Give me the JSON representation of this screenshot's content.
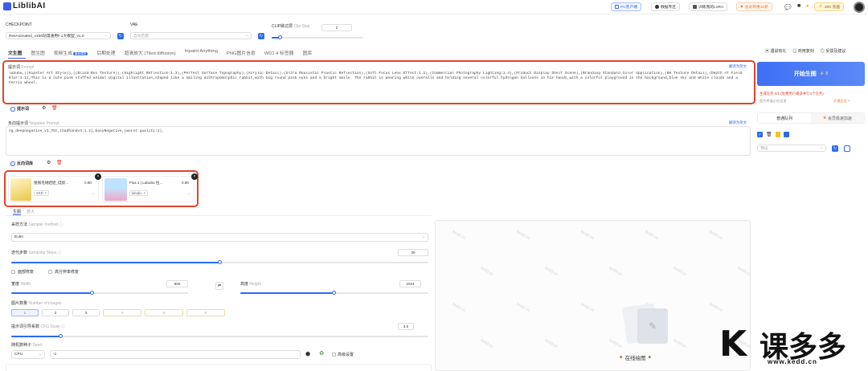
{
  "header": {
    "logo_text": "LiblibAI",
    "pills": [
      {
        "label": "PC客户端",
        "icon": "monitor-icon"
      },
      {
        "label": "数据专区",
        "icon": "chat-icon"
      },
      {
        "label": "训练我的LoRA",
        "icon": "sparkle-icon"
      },
      {
        "label": "会员特惠16折",
        "icon": "heart-icon"
      },
      {
        "label": "200 充值",
        "icon": "lightning-icon"
      }
    ],
    "ai_badge": "AI"
  },
  "model_bar": {
    "checkpoint_label": "CHECKPOINT",
    "checkpoint_value": "RevAnimated_v166动漫通用F.1大模型_v1.0",
    "vae_label": "VAE",
    "vae_value": "自动匹配",
    "clip_label": "CLIP跳过层",
    "clip_label_en": "Clip Skip",
    "clip_value": "2",
    "clip_fraction": 0.1
  },
  "tabs": [
    {
      "label": "文生图",
      "active": true
    },
    {
      "label": "图生图"
    },
    {
      "label": "视频生成",
      "badge": "最新模型"
    },
    {
      "label": "后期处理"
    },
    {
      "label": "超清放大 (Tiled diffusion)"
    },
    {
      "label": "Inpaint Anything"
    },
    {
      "label": "PNG图片信息"
    },
    {
      "label": "WD1.4 标签器"
    },
    {
      "label": "图库"
    }
  ],
  "right_links": {
    "feedback1": "遇说有礼",
    "feedback2": "商用复刻",
    "feedback3": "反馈及建议"
  },
  "prompt": {
    "label": "提示词",
    "label_en": "Prompt",
    "translate": "翻译为英文",
    "text": "labubu,((Hipster Art Style)),((Blind Box Texture)),(Highlight Reflection:1.3),(Perfect Surface Topography),(Acrylic Detail),(Ultra Realistic Plastic Reflection),(Soft Focus Lens Effect:1.1),(Commercial Photography Lighting:1.4),(Product Display Shelf Scene),(Branding Standard Color Application),(8K Texture Detail),(Depth of Field Blur:1.1),This is a cute pink stuffed animal digital illustration,shaped like a smiling anthropomorphic rabbit,with big round pink eyes and a bright smile. The rabbit is wearing white overalls and holding several colorful hydrogen balloons in his hands,with a colorful playground in the background,blue sky and white clouds and a Ferris wheel.",
    "lib_label": "提示词"
  },
  "negative": {
    "label": "负向提示词",
    "label_en": "Negative Prompt",
    "translate": "翻译为英文",
    "text": "ng_deepnegative_v1_75t,(badhandv4:1.2),EasyNegative,(worst quality:2),",
    "lib_label": "反向词库"
  },
  "loras": [
    {
      "name": "锐毁毛绒娃娃_硅胶...",
      "weight": "0.80",
      "tag": "SXD",
      "thumb_color": "#e9c64b"
    },
    {
      "name": "Flux.1 | Labubu 拉...",
      "weight": "0.80",
      "tag": "labubu",
      "thumb_color": "#f4a6c6"
    }
  ],
  "subtabs": {
    "a": "生图",
    "b": "放大"
  },
  "sampling": {
    "label": "采样方法",
    "label_en": "Sampler method",
    "value": "Euler",
    "steps_label": "迭代步数",
    "steps_label_en": "Sampling Steps",
    "steps_value": "30",
    "steps_fraction": 0.5,
    "hires_label": "面部修复",
    "hires2_label": "高分辨率修复",
    "width_label": "宽度",
    "width_label_en": "Width",
    "width_value": "800",
    "width_fraction": 0.46,
    "height_label": "高度",
    "height_label_en": "Height",
    "height_value": "1024",
    "height_fraction": 0.5,
    "count_label": "图片数量",
    "count_label_en": "Number of images",
    "counts": [
      "1",
      "2",
      "3",
      "4",
      "6",
      "8"
    ],
    "cfg_label": "提示词引导系数",
    "cfg_label_en": "CFG Scale",
    "cfg_value": "3.5",
    "cfg_fraction": 0.12,
    "seed_label": "随机数种子",
    "seed_label_en": "Seed",
    "seed_device": "CPU",
    "seed_value": "-1",
    "advanced": "高级设置"
  },
  "generate": {
    "label": "开始生图",
    "cost": "8",
    "task_text": "生成任务 0/1 (免费用户最多并行1个任务)",
    "task_sub": "图片将展示在这里",
    "upgrade": "开通会员 >",
    "queue_tab": "普通队列",
    "fast_tab": "会员极速加速",
    "preset": "预设",
    "canvas_label": "在线绘图"
  },
  "watermark": "kedd.cn",
  "brand": {
    "text": "课多多",
    "url": "www.kedd.cn"
  }
}
